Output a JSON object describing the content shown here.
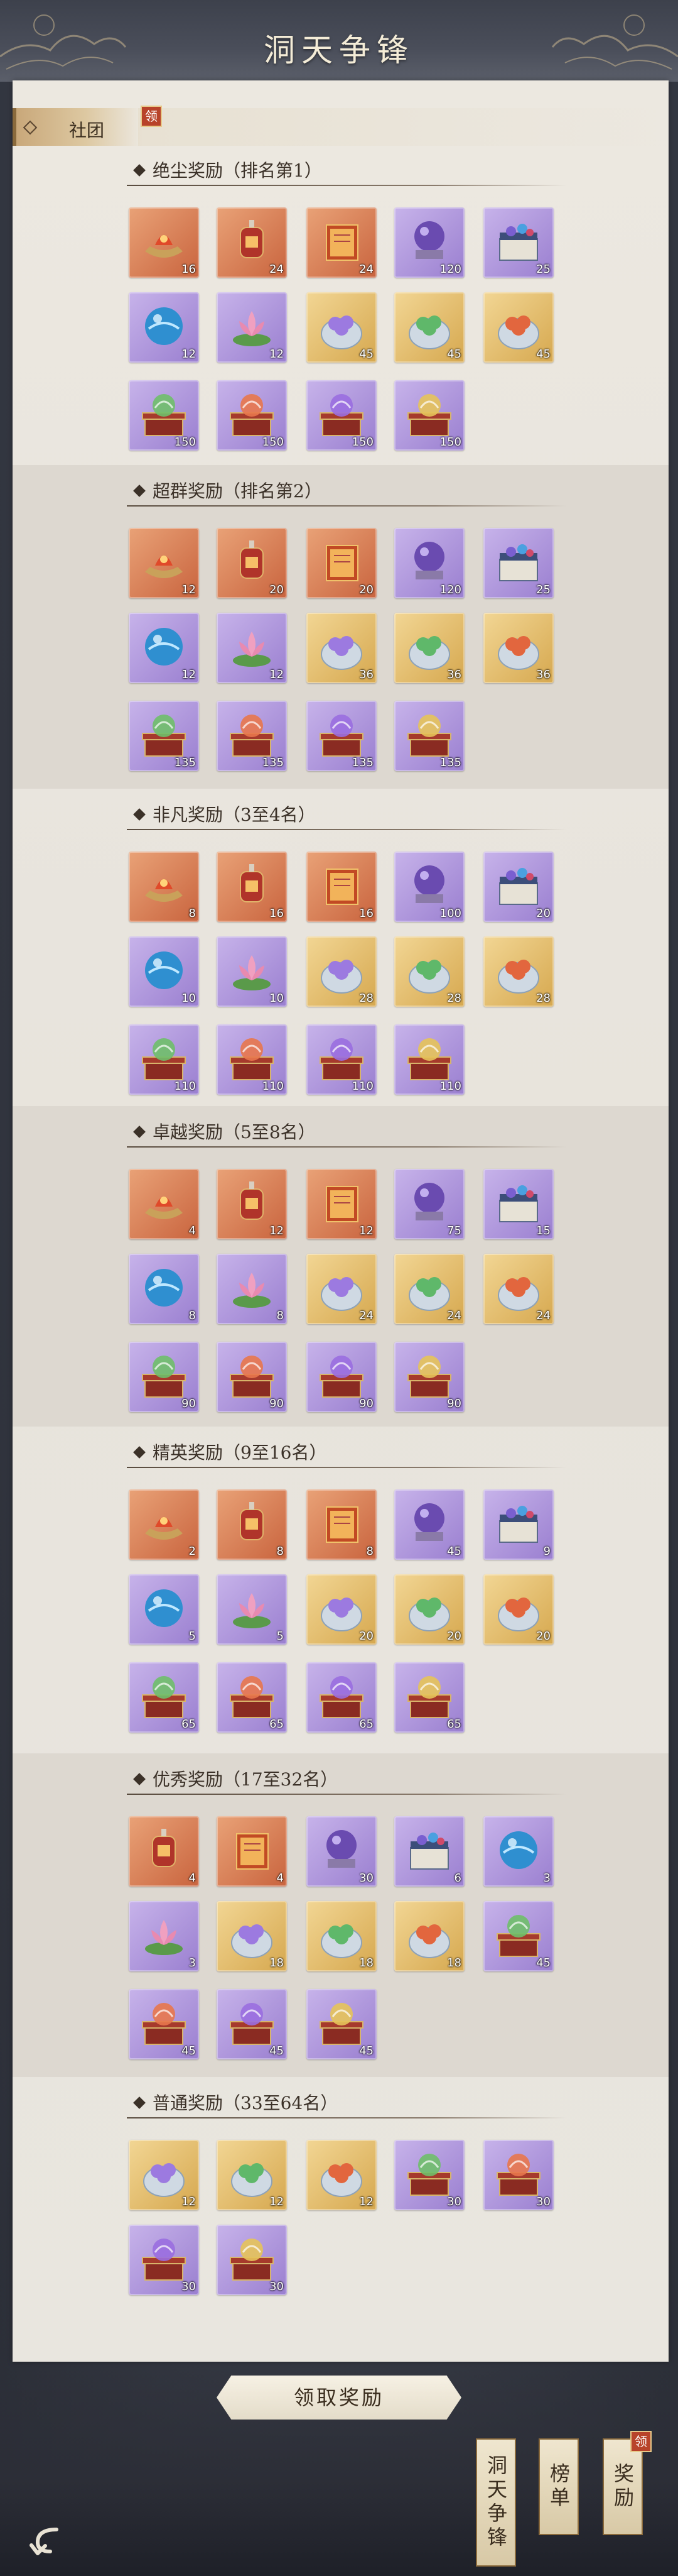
{
  "title": "洞天争锋",
  "club_tab": {
    "label": "社团",
    "badge": "领"
  },
  "sections": [
    {
      "title": "绝尘奖励（排名第1）",
      "rows": [
        [
          {
            "icon": "lamp-orange",
            "q": "orange",
            "n": "16"
          },
          {
            "icon": "lantern-orange",
            "q": "orange",
            "n": "24"
          },
          {
            "icon": "scroll-orange",
            "q": "orange",
            "n": "24"
          },
          {
            "icon": "crystal-orb-purple",
            "q": "purple",
            "n": "120"
          },
          {
            "icon": "chest-purple",
            "q": "purple",
            "n": "25"
          }
        ],
        [
          {
            "icon": "blue-orb",
            "q": "purple",
            "n": "12"
          },
          {
            "icon": "lotus",
            "q": "purple",
            "n": "12"
          },
          {
            "icon": "pot-purple-gems",
            "q": "gold",
            "n": "45"
          },
          {
            "icon": "pot-green-gems",
            "q": "gold",
            "n": "45"
          },
          {
            "icon": "pot-red-gems",
            "q": "gold",
            "n": "45"
          }
        ],
        [
          {
            "icon": "box-green",
            "q": "purple",
            "n": "150"
          },
          {
            "icon": "box-orange",
            "q": "purple",
            "n": "150"
          },
          {
            "icon": "box-purple",
            "q": "purple",
            "n": "150"
          },
          {
            "icon": "box-gold",
            "q": "purple",
            "n": "150"
          }
        ]
      ]
    },
    {
      "title": "超群奖励（排名第2）",
      "rows": [
        [
          {
            "icon": "lamp-orange",
            "q": "orange",
            "n": "12"
          },
          {
            "icon": "lantern-orange",
            "q": "orange",
            "n": "20"
          },
          {
            "icon": "scroll-orange",
            "q": "orange",
            "n": "20"
          },
          {
            "icon": "crystal-orb-purple",
            "q": "purple",
            "n": "120"
          },
          {
            "icon": "chest-purple",
            "q": "purple",
            "n": "25"
          }
        ],
        [
          {
            "icon": "blue-orb",
            "q": "purple",
            "n": "12"
          },
          {
            "icon": "lotus",
            "q": "purple",
            "n": "12"
          },
          {
            "icon": "pot-purple-gems",
            "q": "gold",
            "n": "36"
          },
          {
            "icon": "pot-green-gems",
            "q": "gold",
            "n": "36"
          },
          {
            "icon": "pot-red-gems",
            "q": "gold",
            "n": "36"
          }
        ],
        [
          {
            "icon": "box-green",
            "q": "purple",
            "n": "135"
          },
          {
            "icon": "box-orange",
            "q": "purple",
            "n": "135"
          },
          {
            "icon": "box-purple",
            "q": "purple",
            "n": "135"
          },
          {
            "icon": "box-gold",
            "q": "purple",
            "n": "135"
          }
        ]
      ]
    },
    {
      "title": "非凡奖励（3至4名）",
      "rows": [
        [
          {
            "icon": "lamp-orange",
            "q": "orange",
            "n": "8"
          },
          {
            "icon": "lantern-orange",
            "q": "orange",
            "n": "16"
          },
          {
            "icon": "scroll-orange",
            "q": "orange",
            "n": "16"
          },
          {
            "icon": "crystal-orb-purple",
            "q": "purple",
            "n": "100"
          },
          {
            "icon": "chest-purple",
            "q": "purple",
            "n": "20"
          }
        ],
        [
          {
            "icon": "blue-orb",
            "q": "purple",
            "n": "10"
          },
          {
            "icon": "lotus",
            "q": "purple",
            "n": "10"
          },
          {
            "icon": "pot-purple-gems",
            "q": "gold",
            "n": "28"
          },
          {
            "icon": "pot-green-gems",
            "q": "gold",
            "n": "28"
          },
          {
            "icon": "pot-red-gems",
            "q": "gold",
            "n": "28"
          }
        ],
        [
          {
            "icon": "box-green",
            "q": "purple",
            "n": "110"
          },
          {
            "icon": "box-orange",
            "q": "purple",
            "n": "110"
          },
          {
            "icon": "box-purple",
            "q": "purple",
            "n": "110"
          },
          {
            "icon": "box-gold",
            "q": "purple",
            "n": "110"
          }
        ]
      ]
    },
    {
      "title": "卓越奖励（5至8名）",
      "rows": [
        [
          {
            "icon": "lamp-orange",
            "q": "orange",
            "n": "4"
          },
          {
            "icon": "lantern-orange",
            "q": "orange",
            "n": "12"
          },
          {
            "icon": "scroll-orange",
            "q": "orange",
            "n": "12"
          },
          {
            "icon": "crystal-orb-purple",
            "q": "purple",
            "n": "75"
          },
          {
            "icon": "chest-purple",
            "q": "purple",
            "n": "15"
          }
        ],
        [
          {
            "icon": "blue-orb",
            "q": "purple",
            "n": "8"
          },
          {
            "icon": "lotus",
            "q": "purple",
            "n": "8"
          },
          {
            "icon": "pot-purple-gems",
            "q": "gold",
            "n": "24"
          },
          {
            "icon": "pot-green-gems",
            "q": "gold",
            "n": "24"
          },
          {
            "icon": "pot-red-gems",
            "q": "gold",
            "n": "24"
          }
        ],
        [
          {
            "icon": "box-green",
            "q": "purple",
            "n": "90"
          },
          {
            "icon": "box-orange",
            "q": "purple",
            "n": "90"
          },
          {
            "icon": "box-purple",
            "q": "purple",
            "n": "90"
          },
          {
            "icon": "box-gold",
            "q": "purple",
            "n": "90"
          }
        ]
      ]
    },
    {
      "title": "精英奖励（9至16名）",
      "rows": [
        [
          {
            "icon": "lamp-orange",
            "q": "orange",
            "n": "2"
          },
          {
            "icon": "lantern-orange",
            "q": "orange",
            "n": "8"
          },
          {
            "icon": "scroll-orange",
            "q": "orange",
            "n": "8"
          },
          {
            "icon": "crystal-orb-purple",
            "q": "purple",
            "n": "45"
          },
          {
            "icon": "chest-purple",
            "q": "purple",
            "n": "9"
          }
        ],
        [
          {
            "icon": "blue-orb",
            "q": "purple",
            "n": "5"
          },
          {
            "icon": "lotus",
            "q": "purple",
            "n": "5"
          },
          {
            "icon": "pot-purple-gems",
            "q": "gold",
            "n": "20"
          },
          {
            "icon": "pot-green-gems",
            "q": "gold",
            "n": "20"
          },
          {
            "icon": "pot-red-gems",
            "q": "gold",
            "n": "20"
          }
        ],
        [
          {
            "icon": "box-green",
            "q": "purple",
            "n": "65"
          },
          {
            "icon": "box-orange",
            "q": "purple",
            "n": "65"
          },
          {
            "icon": "box-purple",
            "q": "purple",
            "n": "65"
          },
          {
            "icon": "box-gold",
            "q": "purple",
            "n": "65"
          }
        ]
      ]
    },
    {
      "title": "优秀奖励（17至32名）",
      "rows": [
        [
          {
            "icon": "lantern-orange",
            "q": "orange",
            "n": "4"
          },
          {
            "icon": "scroll-orange",
            "q": "orange",
            "n": "4"
          },
          {
            "icon": "crystal-orb-purple",
            "q": "purple",
            "n": "30"
          },
          {
            "icon": "chest-purple",
            "q": "purple",
            "n": "6"
          },
          {
            "icon": "blue-orb",
            "q": "purple",
            "n": "3"
          }
        ],
        [
          {
            "icon": "lotus",
            "q": "purple",
            "n": "3"
          },
          {
            "icon": "pot-purple-gems",
            "q": "gold",
            "n": "18"
          },
          {
            "icon": "pot-green-gems",
            "q": "gold",
            "n": "18"
          },
          {
            "icon": "pot-red-gems",
            "q": "gold",
            "n": "18"
          },
          {
            "icon": "box-green",
            "q": "purple",
            "n": "45"
          }
        ],
        [
          {
            "icon": "box-orange",
            "q": "purple",
            "n": "45"
          },
          {
            "icon": "box-purple",
            "q": "purple",
            "n": "45"
          },
          {
            "icon": "box-gold",
            "q": "purple",
            "n": "45"
          }
        ]
      ]
    },
    {
      "title": "普通奖励（33至64名）",
      "rows": [
        [
          {
            "icon": "pot-purple-gems",
            "q": "gold",
            "n": "12"
          },
          {
            "icon": "pot-green-gems",
            "q": "gold",
            "n": "12"
          },
          {
            "icon": "pot-red-gems",
            "q": "gold",
            "n": "12"
          },
          {
            "icon": "box-green",
            "q": "purple",
            "n": "30"
          },
          {
            "icon": "box-orange",
            "q": "purple",
            "n": "30"
          }
        ],
        [
          {
            "icon": "box-purple",
            "q": "purple",
            "n": "30"
          },
          {
            "icon": "box-gold",
            "q": "purple",
            "n": "30"
          }
        ]
      ]
    }
  ],
  "claim_button": "领取奖励",
  "side_tabs": [
    {
      "label": "洞天争锋",
      "badge": ""
    },
    {
      "label": "榜单",
      "badge": ""
    },
    {
      "label": "奖励",
      "badge": "领"
    }
  ],
  "colors": {
    "quality_orange": "#d9825a",
    "quality_purple": "#b29ade",
    "quality_gold": "#e8c273",
    "badge_red": "#b8432a"
  }
}
